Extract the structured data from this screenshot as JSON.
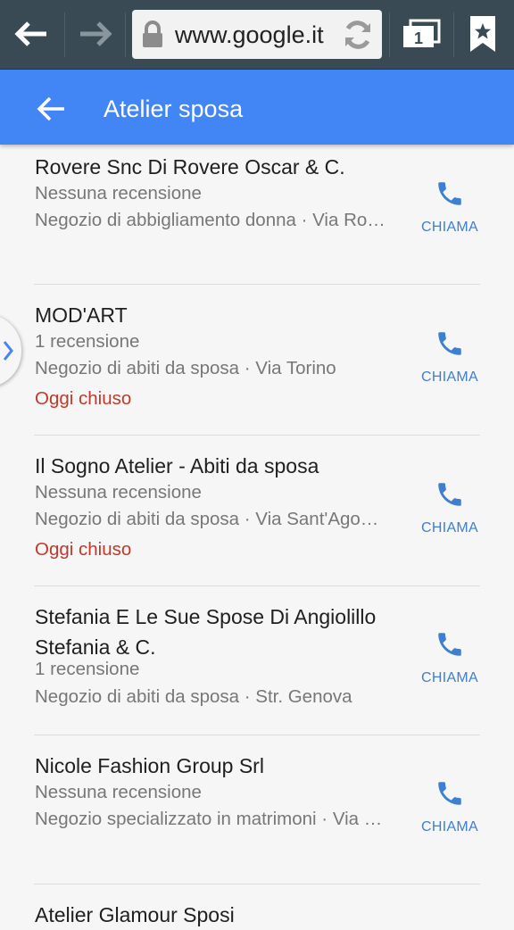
{
  "browser": {
    "url": "www.google.it",
    "tab_count": "1"
  },
  "app_bar": {
    "title": "Atelier sposa"
  },
  "results": [
    {
      "name": "Rovere Snc Di Rovere Oscar & C.",
      "reviews": "Nessuna recensione",
      "category": "Negozio di abbigliamento donna · Via Ro…",
      "status": "",
      "action": "CHIAMA"
    },
    {
      "name": "MOD'ART",
      "reviews": "1 recensione",
      "category": "Negozio di abiti da sposa · Via Torino",
      "status": "Oggi chiuso",
      "action": "CHIAMA"
    },
    {
      "name": "Il Sogno Atelier - Abiti da sposa",
      "reviews": "Nessuna recensione",
      "category": "Negozio di abiti da sposa · Via Sant'Ago…",
      "status": "Oggi chiuso",
      "action": "CHIAMA"
    },
    {
      "name": "Stefania E Le Sue Spose Di Angiolillo Stefania & C.",
      "reviews": "1 recensione",
      "category": "Negozio di abiti da sposa · Str. Genova",
      "status": "",
      "action": "CHIAMA"
    },
    {
      "name": "Nicole Fashion Group Srl",
      "reviews": "Nessuna recensione",
      "category": "Negozio specializzato in matrimoni · Via …",
      "status": "",
      "action": "CHIAMA"
    },
    {
      "name": "Atelier Glamour Sposi"
    }
  ],
  "colors": {
    "app_bar": "#4285f4",
    "browser_bar": "#3a4a55",
    "closed": "#c0392b",
    "call": "#3f7fd0"
  }
}
